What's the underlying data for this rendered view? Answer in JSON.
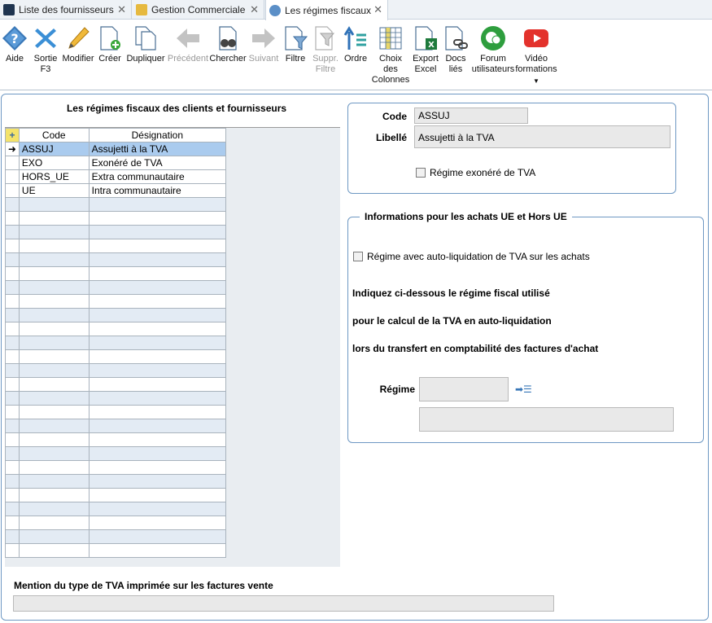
{
  "tabs": [
    {
      "label": "Liste des fournisseurs",
      "active": false
    },
    {
      "label": "Gestion Commerciale",
      "active": false
    },
    {
      "label": "Les régimes fiscaux",
      "active": true
    }
  ],
  "toolbar": {
    "aide": "Aide",
    "sortie": "Sortie\nF3",
    "modifier": "Modifier",
    "creer": "Créer",
    "dupliquer": "Dupliquer",
    "precedent": "Précédent",
    "chercher": "Chercher",
    "suivant": "Suivant",
    "filtre": "Filtre",
    "suppr_filtre": "Suppr.\nFiltre",
    "ordre": "Ordre",
    "choix_colonnes": "Choix\ndes\nColonnes",
    "export_excel": "Export\nExcel",
    "docs_lies": "Docs\nliés",
    "forum": "Forum\nutilisateurs",
    "video": "Vidéo\nformations"
  },
  "grid": {
    "title": "Les régimes fiscaux des clients et fournisseurs",
    "col_code": "Code",
    "col_designation": "Désignation",
    "rows": [
      {
        "code": "ASSUJ",
        "designation": "Assujetti à la TVA"
      },
      {
        "code": "EXO",
        "designation": "Exonéré de TVA"
      },
      {
        "code": "HORS_UE",
        "designation": "Extra communautaire"
      },
      {
        "code": "UE",
        "designation": "Intra communautaire"
      }
    ]
  },
  "detail": {
    "code_label": "Code",
    "code_value": "ASSUJ",
    "libelle_label": "Libellé",
    "libelle_value": "Assujetti à la TVA",
    "exonere_label": "Régime exonéré de TVA",
    "exonere_checked": false
  },
  "ue": {
    "legend": "Informations pour les achats UE et Hors UE",
    "autoliq_label": "Régime avec auto-liquidation de TVA sur les achats",
    "autoliq_checked": false,
    "text1": "Indiquez ci-dessous le régime fiscal utilisé",
    "text2": "pour le calcul de la TVA en auto-liquidation",
    "text3": "lors du transfert en comptabilité des factures d'achat",
    "regime_label": "Régime",
    "regime_value": "",
    "regime_desc": ""
  },
  "mention": {
    "label": "Mention du type de TVA imprimée sur les factures vente",
    "value": ""
  },
  "colors": {
    "accent": "#6e98c3",
    "selection": "#aacbee",
    "field_bg": "#e9e9e9"
  }
}
